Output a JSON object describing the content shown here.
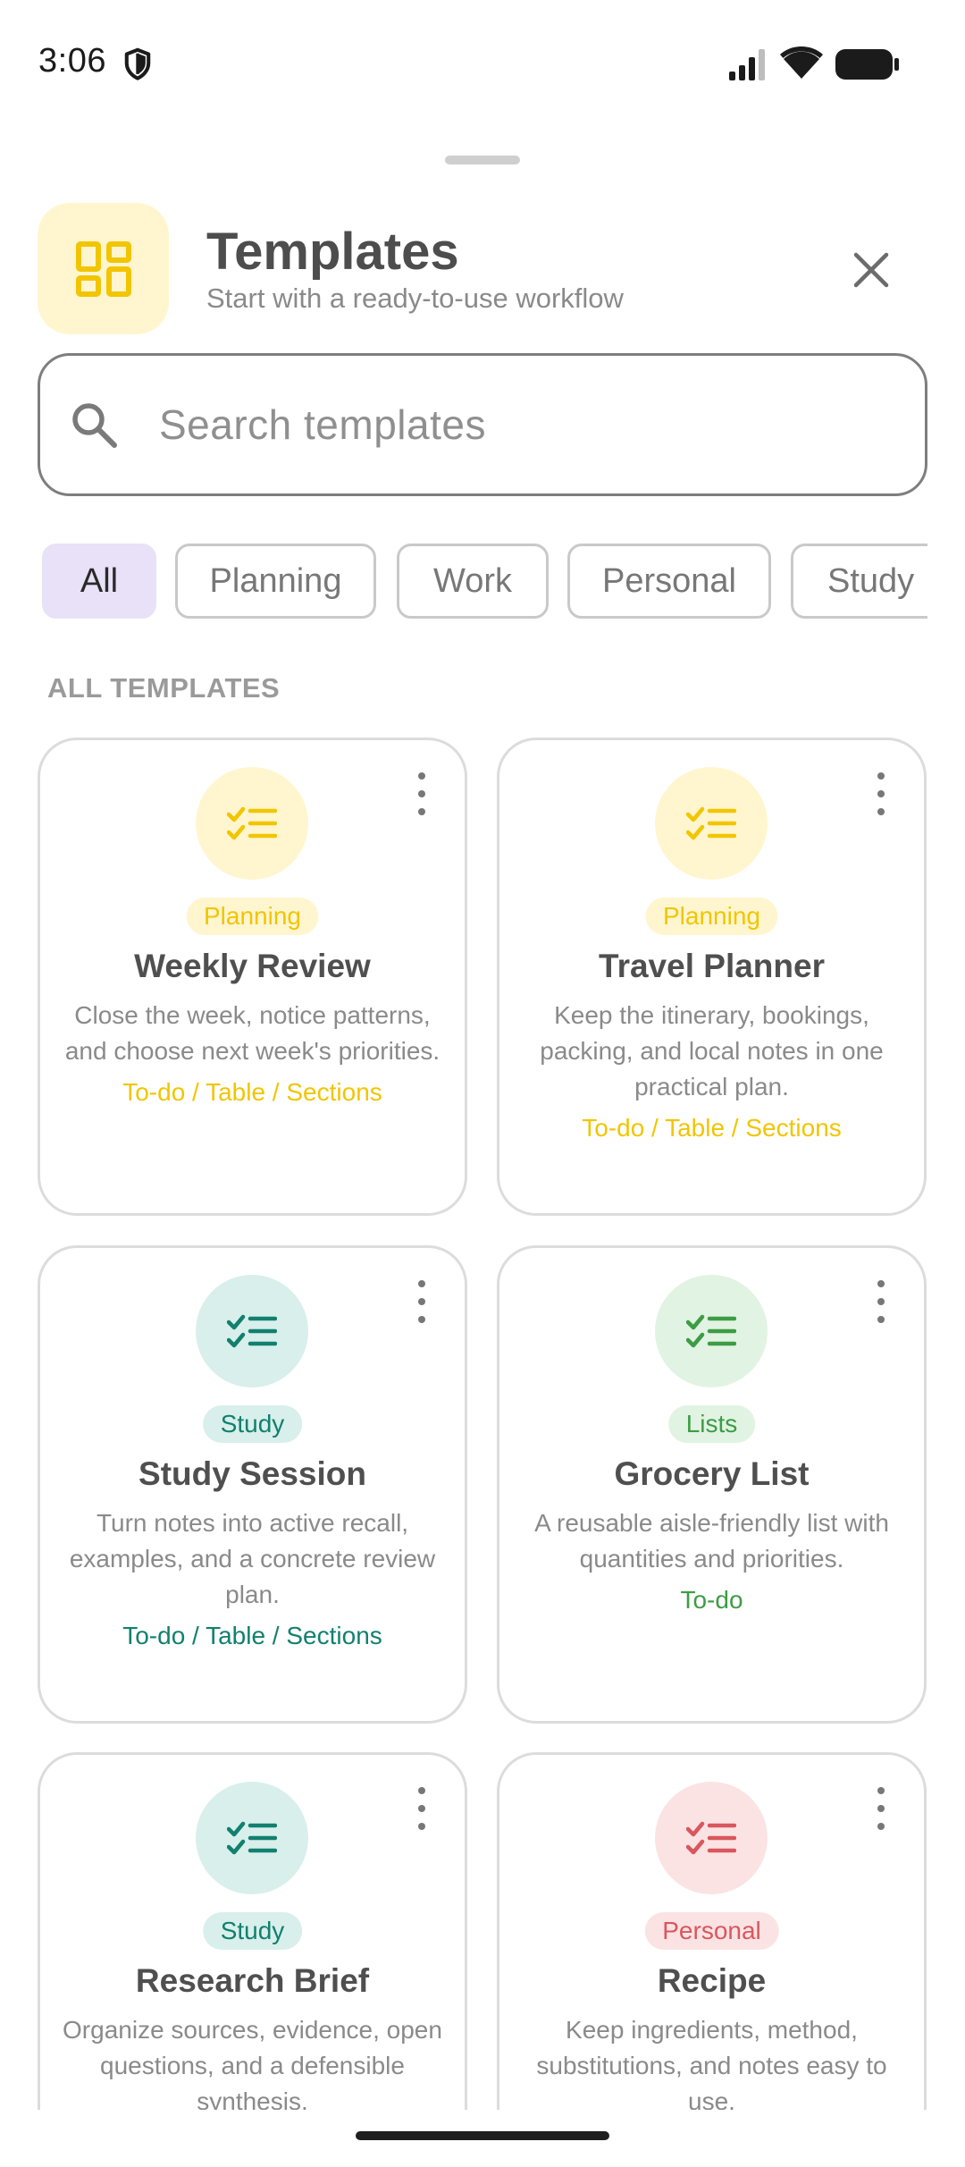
{
  "status_bar": {
    "time": "3:06",
    "icons": [
      "shield-icon",
      "signal-icon",
      "wifi-icon",
      "battery-icon"
    ]
  },
  "header": {
    "icon": "templates-grid-icon",
    "title": "Templates",
    "subtitle": "Start with a ready-to-use workflow",
    "close_icon": "close-icon"
  },
  "search": {
    "placeholder": "Search templates",
    "value": ""
  },
  "filters": {
    "chips": [
      "All",
      "Planning",
      "Work",
      "Personal",
      "Study"
    ],
    "selected": "All"
  },
  "section_label": "ALL TEMPLATES",
  "colors": {
    "planning_accent": "#f2c500",
    "planning_bg": "#fff6cf",
    "study_accent": "#12806f",
    "study_bg": "#d9efeb",
    "lists_accent": "#3d9c45",
    "lists_bg": "#e1f3e2",
    "personal_accent": "#d9575e",
    "personal_bg": "#fbe3e4",
    "selected_chip_bg": "#e9e1f7"
  },
  "templates": [
    {
      "tag": "Planning",
      "title": "Weekly Review",
      "description": "Close the week, notice patterns, and choose next week's priorities.",
      "types": "To-do / Table / Sections"
    },
    {
      "tag": "Planning",
      "title": "Travel Planner",
      "description": "Keep the itinerary, bookings, packing, and local notes in one practical plan.",
      "types": "To-do / Table / Sections"
    },
    {
      "tag": "Study",
      "title": "Study Session",
      "description": "Turn notes into active recall, examples, and a concrete review plan.",
      "types": "To-do / Table / Sections"
    },
    {
      "tag": "Lists",
      "title": "Grocery List",
      "description": "A reusable aisle-friendly list with quantities and priorities.",
      "types": "To-do"
    },
    {
      "tag": "Study",
      "title": "Research Brief",
      "description": "Organize sources, evidence, open questions, and a defensible synthesis.",
      "types": ""
    },
    {
      "tag": "Personal",
      "title": "Recipe",
      "description": "Keep ingredients, method, substitutions, and notes easy to use.",
      "types": ""
    }
  ]
}
